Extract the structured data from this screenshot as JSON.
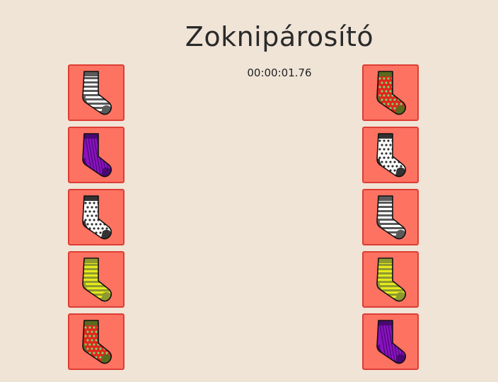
{
  "game": {
    "title": "Zoknipárosító",
    "timer": "00:00:01.76"
  },
  "left_column": [
    {
      "sock": "white-gray-striped-sock-icon",
      "pattern": "stripes",
      "base": "#ffffff",
      "accent": "#5a5a5a"
    },
    {
      "sock": "purple-ribbed-sock-icon",
      "pattern": "ribbed",
      "base": "#8a12c0",
      "accent": "#4a0872"
    },
    {
      "sock": "white-polka-dot-sock-icon",
      "pattern": "dots",
      "base": "#ffffff",
      "accent": "#333333"
    },
    {
      "sock": "yellow-striped-sock-icon",
      "pattern": "stripes",
      "base": "#e6ea1c",
      "accent": "#8f9a2e"
    },
    {
      "sock": "red-green-dotted-sock-icon",
      "pattern": "dots",
      "base": "#e2241c",
      "accent": "#5a6a1f"
    }
  ],
  "right_column": [
    {
      "sock": "red-green-dotted-sock-icon",
      "pattern": "dots",
      "base": "#e2241c",
      "accent": "#5a6a1f"
    },
    {
      "sock": "white-polka-dot-sock-icon",
      "pattern": "dots",
      "base": "#ffffff",
      "accent": "#333333"
    },
    {
      "sock": "white-gray-striped-sock-icon",
      "pattern": "stripes",
      "base": "#ffffff",
      "accent": "#5a5a5a"
    },
    {
      "sock": "yellow-striped-sock-icon",
      "pattern": "stripes",
      "base": "#e6ea1c",
      "accent": "#8f9a2e"
    },
    {
      "sock": "purple-ribbed-sock-icon",
      "pattern": "ribbed",
      "base": "#8a12c0",
      "accent": "#4a0872"
    }
  ]
}
